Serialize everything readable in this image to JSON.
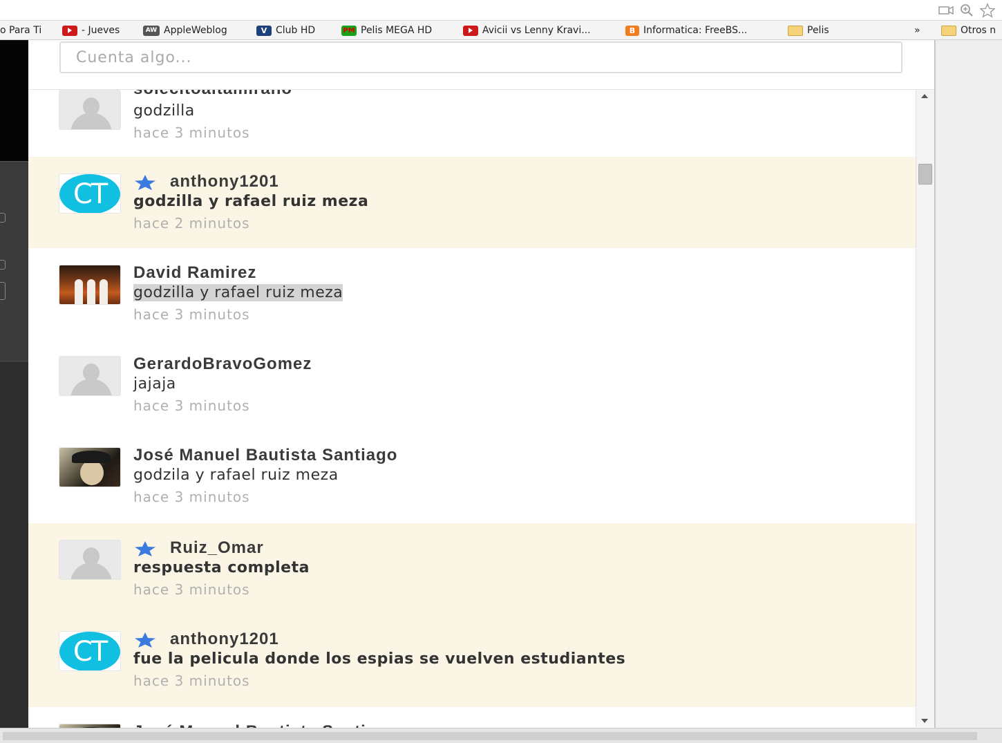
{
  "bookmarks": [
    {
      "label": "o Para Ti",
      "icon": "none"
    },
    {
      "label": "- Jueves",
      "icon": "youtube-icon"
    },
    {
      "label": "AppleWeblog",
      "icon": "aw-icon"
    },
    {
      "label": "Club HD",
      "icon": "club-hd-icon"
    },
    {
      "label": "Pelis MEGA HD",
      "icon": "pm-icon"
    },
    {
      "label": "Avicii vs Lenny Kravi...",
      "icon": "youtube-icon"
    },
    {
      "label": "Informatica: FreeBS...",
      "icon": "blogger-icon"
    },
    {
      "label": "Pelis",
      "icon": "folder-icon"
    },
    {
      "label": "»",
      "icon": "none"
    },
    {
      "label": "Otros n",
      "icon": "folder-icon"
    }
  ],
  "compose": {
    "placeholder": "Cuenta algo..."
  },
  "feed": [
    {
      "user": "solecitoaltamirano",
      "message": "godzilla",
      "time": "hace 3 minutos",
      "starred": false,
      "highlighted": false,
      "avatar": "default"
    },
    {
      "user": "anthony1201",
      "message": "godzilla y rafael ruiz meza",
      "time": "hace 2 minutos",
      "starred": true,
      "highlighted": true,
      "avatar": "CT"
    },
    {
      "user": "David Ramirez",
      "message": "godzilla y rafael ruiz meza",
      "time": "hace 3 minutos",
      "starred": false,
      "highlighted": false,
      "avatar": "photo"
    },
    {
      "user": "GerardoBravoGomez",
      "message": "jajaja",
      "time": "hace 3 minutos",
      "starred": false,
      "highlighted": false,
      "avatar": "default"
    },
    {
      "user": "José Manuel Bautista Santiago",
      "message": "godzila y rafael ruiz meza",
      "time": "hace 3 minutos",
      "starred": false,
      "highlighted": false,
      "avatar": "photo"
    },
    {
      "user": "Ruiz_Omar",
      "message": "respuesta completa",
      "time": "hace 3 minutos",
      "starred": true,
      "highlighted": true,
      "avatar": "default"
    },
    {
      "user": "anthony1201",
      "message": "fue la pelicula donde los espias se vuelven estudiantes",
      "time": "hace 3 minutos",
      "starred": true,
      "highlighted": true,
      "avatar": "CT"
    },
    {
      "user": "José Manuel Bautista Santiago",
      "message": "",
      "time": "",
      "starred": false,
      "highlighted": false,
      "avatar": "photo"
    }
  ],
  "avatar_text": "CT",
  "colors": {
    "highlight_bg": "#faf5e4",
    "star": "#3b7be0",
    "ct_avatar": "#11bfe0",
    "time_text": "#b0b0b0"
  }
}
